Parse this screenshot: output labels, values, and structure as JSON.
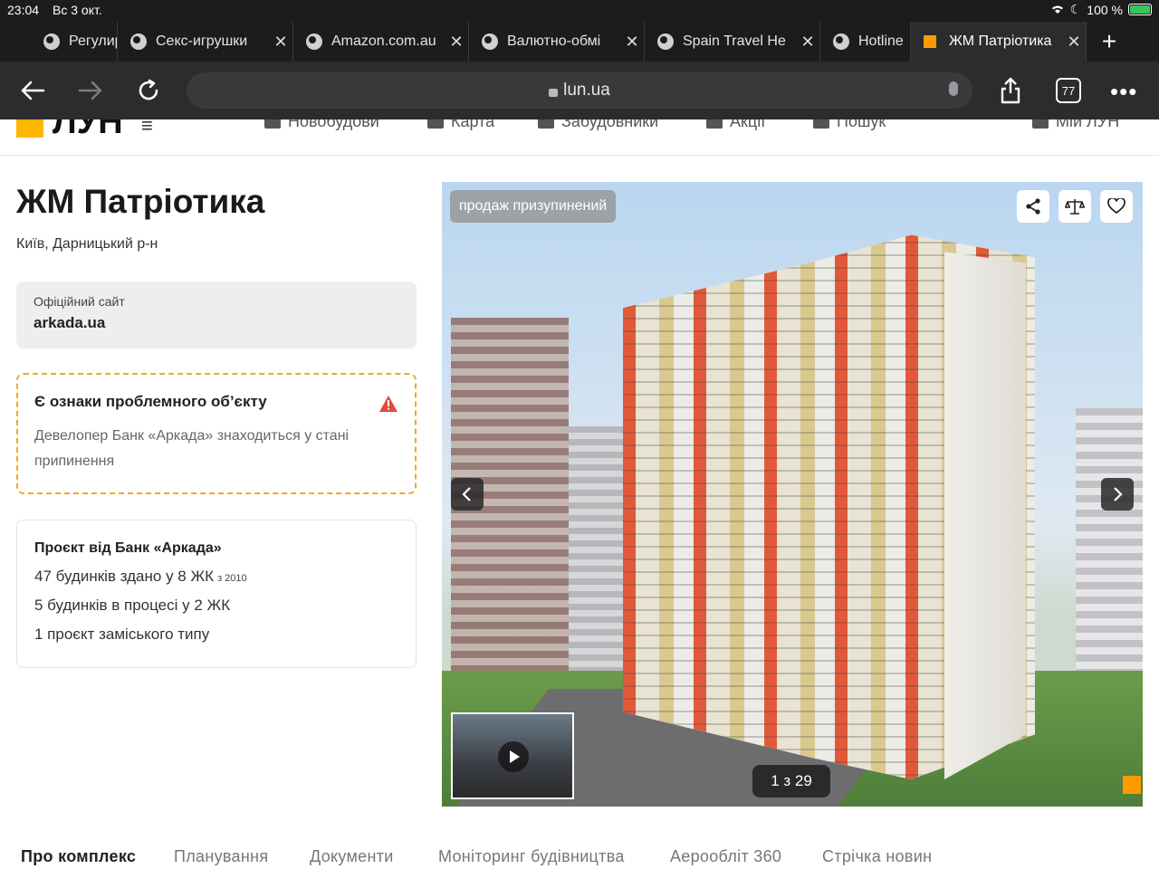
{
  "status": {
    "time": "23:04",
    "date": "Вс 3 окт.",
    "battery": "100 %"
  },
  "tabs": [
    {
      "label": "Регулиру",
      "active": false
    },
    {
      "label": "Секс-игрушки",
      "active": false
    },
    {
      "label": "Amazon.com.au",
      "active": false
    },
    {
      "label": "Валютно-обмі",
      "active": false
    },
    {
      "label": "Spain Travel He",
      "active": false
    },
    {
      "label": "Hotline",
      "active": false
    },
    {
      "label": "ЖМ Патріотика",
      "active": true
    }
  ],
  "toolbar": {
    "url": "lun.ua",
    "tab_count": "77"
  },
  "site": {
    "logo": "ЛУН",
    "nav": [
      "Новобудови",
      "Карта",
      "Забудовники",
      "Акції",
      "Пошук",
      "Мій ЛУН"
    ]
  },
  "complex": {
    "title": "ЖМ Патріотика",
    "location": "Київ, Дарницький р-н",
    "official_site_label": "Офіційний сайт",
    "official_site": "arkada.ua"
  },
  "warning": {
    "title": "Є ознаки проблемного об’єкту",
    "text": "Девелопер Банк «Аркада» знаходиться у стані припинення"
  },
  "developer": {
    "title": "Проєкт від Банк «Аркада»",
    "built": "47 будинків здано у 8 ЖК",
    "since": "з 2010",
    "in_progress": "5 будинків в процесі у 2 ЖК",
    "suburban": "1 проєкт заміського типу"
  },
  "gallery": {
    "badge": "продаж призупинений",
    "counter": "1 з 29"
  },
  "section_tabs": [
    "Про комплекс",
    "Планування",
    "Документи",
    "Моніторинг будівництва",
    "Аерообліт 360",
    "Стрічка новин"
  ],
  "colors": {
    "accent": "#ffb600",
    "warning": "#f5a623",
    "danger": "#e04b3a"
  }
}
